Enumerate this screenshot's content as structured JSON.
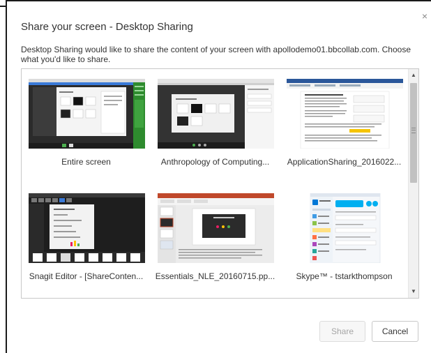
{
  "dialog": {
    "title": "Share your screen - Desktop Sharing",
    "description": "Desktop Sharing would like to share the content of your screen with apollodemo01.bbcollab.com. Choose what you'd like to share.",
    "close_glyph": "×"
  },
  "sources": [
    {
      "label": "Entire screen"
    },
    {
      "label": "Anthropology of Computing..."
    },
    {
      "label": "ApplicationSharing_2016022..."
    },
    {
      "label": "Snagit Editor - [ShareConten..."
    },
    {
      "label": "Essentials_NLE_20160715.pp..."
    },
    {
      "label": "Skype™ - tstarkthompson"
    }
  ],
  "scrollbar": {
    "up_glyph": "▲",
    "down_glyph": "▼"
  },
  "buttons": {
    "share_label": "Share",
    "cancel_label": "Cancel"
  },
  "colors": {
    "share_disabled_text": "#a6a6a6",
    "border": "#c8c8c8",
    "text": "#333333"
  }
}
